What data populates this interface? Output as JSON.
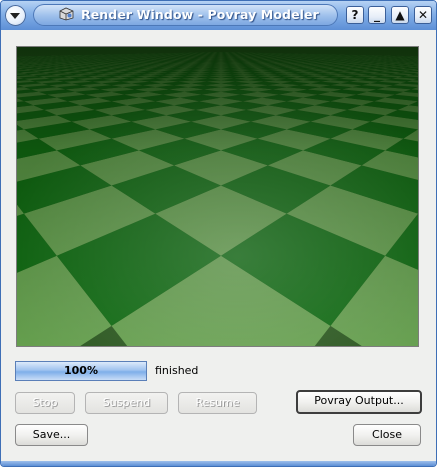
{
  "window": {
    "title": "Render Window - Povray Modeler",
    "buttons": {
      "help": "?",
      "minimize": "_",
      "maximize": "▲",
      "close": "✕"
    }
  },
  "render": {
    "scene": "checkered-plane",
    "colors": {
      "dark_square": "#0f6e12",
      "light_square": "#6aa552"
    }
  },
  "progress": {
    "value": 100,
    "label": "100%",
    "status": "finished"
  },
  "buttons": {
    "stop": "Stop",
    "suspend": "Suspend",
    "resume": "Resume",
    "povray_output": "Povray Output...",
    "save": "Save...",
    "close": "Close"
  },
  "theme": {
    "accent": "#5d8fd6",
    "dialog_bg": "#eff0ee"
  }
}
